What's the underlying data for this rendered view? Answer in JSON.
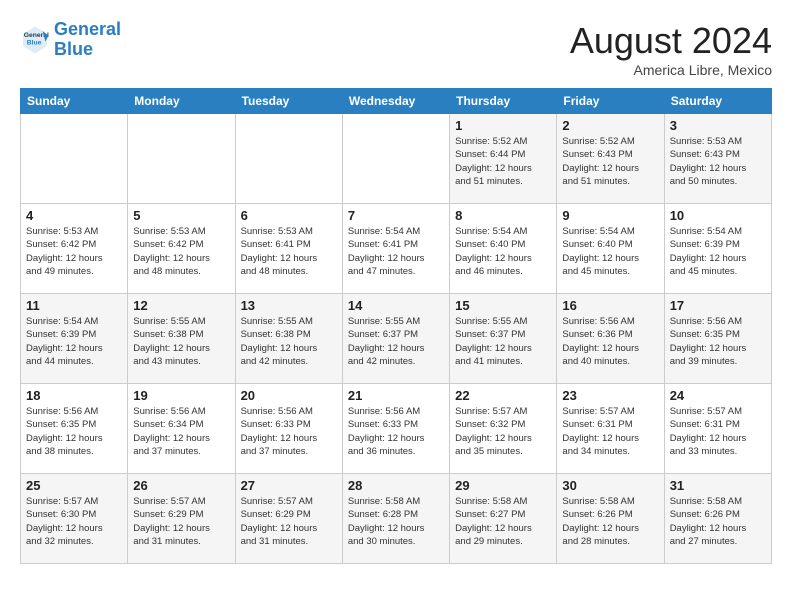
{
  "logo": {
    "line1": "General",
    "line2": "Blue"
  },
  "title": "August 2024",
  "subtitle": "America Libre, Mexico",
  "days_of_week": [
    "Sunday",
    "Monday",
    "Tuesday",
    "Wednesday",
    "Thursday",
    "Friday",
    "Saturday"
  ],
  "weeks": [
    [
      {
        "num": "",
        "info": ""
      },
      {
        "num": "",
        "info": ""
      },
      {
        "num": "",
        "info": ""
      },
      {
        "num": "",
        "info": ""
      },
      {
        "num": "1",
        "info": "Sunrise: 5:52 AM\nSunset: 6:44 PM\nDaylight: 12 hours\nand 51 minutes."
      },
      {
        "num": "2",
        "info": "Sunrise: 5:52 AM\nSunset: 6:43 PM\nDaylight: 12 hours\nand 51 minutes."
      },
      {
        "num": "3",
        "info": "Sunrise: 5:53 AM\nSunset: 6:43 PM\nDaylight: 12 hours\nand 50 minutes."
      }
    ],
    [
      {
        "num": "4",
        "info": "Sunrise: 5:53 AM\nSunset: 6:42 PM\nDaylight: 12 hours\nand 49 minutes."
      },
      {
        "num": "5",
        "info": "Sunrise: 5:53 AM\nSunset: 6:42 PM\nDaylight: 12 hours\nand 48 minutes."
      },
      {
        "num": "6",
        "info": "Sunrise: 5:53 AM\nSunset: 6:41 PM\nDaylight: 12 hours\nand 48 minutes."
      },
      {
        "num": "7",
        "info": "Sunrise: 5:54 AM\nSunset: 6:41 PM\nDaylight: 12 hours\nand 47 minutes."
      },
      {
        "num": "8",
        "info": "Sunrise: 5:54 AM\nSunset: 6:40 PM\nDaylight: 12 hours\nand 46 minutes."
      },
      {
        "num": "9",
        "info": "Sunrise: 5:54 AM\nSunset: 6:40 PM\nDaylight: 12 hours\nand 45 minutes."
      },
      {
        "num": "10",
        "info": "Sunrise: 5:54 AM\nSunset: 6:39 PM\nDaylight: 12 hours\nand 45 minutes."
      }
    ],
    [
      {
        "num": "11",
        "info": "Sunrise: 5:54 AM\nSunset: 6:39 PM\nDaylight: 12 hours\nand 44 minutes."
      },
      {
        "num": "12",
        "info": "Sunrise: 5:55 AM\nSunset: 6:38 PM\nDaylight: 12 hours\nand 43 minutes."
      },
      {
        "num": "13",
        "info": "Sunrise: 5:55 AM\nSunset: 6:38 PM\nDaylight: 12 hours\nand 42 minutes."
      },
      {
        "num": "14",
        "info": "Sunrise: 5:55 AM\nSunset: 6:37 PM\nDaylight: 12 hours\nand 42 minutes."
      },
      {
        "num": "15",
        "info": "Sunrise: 5:55 AM\nSunset: 6:37 PM\nDaylight: 12 hours\nand 41 minutes."
      },
      {
        "num": "16",
        "info": "Sunrise: 5:56 AM\nSunset: 6:36 PM\nDaylight: 12 hours\nand 40 minutes."
      },
      {
        "num": "17",
        "info": "Sunrise: 5:56 AM\nSunset: 6:35 PM\nDaylight: 12 hours\nand 39 minutes."
      }
    ],
    [
      {
        "num": "18",
        "info": "Sunrise: 5:56 AM\nSunset: 6:35 PM\nDaylight: 12 hours\nand 38 minutes."
      },
      {
        "num": "19",
        "info": "Sunrise: 5:56 AM\nSunset: 6:34 PM\nDaylight: 12 hours\nand 37 minutes."
      },
      {
        "num": "20",
        "info": "Sunrise: 5:56 AM\nSunset: 6:33 PM\nDaylight: 12 hours\nand 37 minutes."
      },
      {
        "num": "21",
        "info": "Sunrise: 5:56 AM\nSunset: 6:33 PM\nDaylight: 12 hours\nand 36 minutes."
      },
      {
        "num": "22",
        "info": "Sunrise: 5:57 AM\nSunset: 6:32 PM\nDaylight: 12 hours\nand 35 minutes."
      },
      {
        "num": "23",
        "info": "Sunrise: 5:57 AM\nSunset: 6:31 PM\nDaylight: 12 hours\nand 34 minutes."
      },
      {
        "num": "24",
        "info": "Sunrise: 5:57 AM\nSunset: 6:31 PM\nDaylight: 12 hours\nand 33 minutes."
      }
    ],
    [
      {
        "num": "25",
        "info": "Sunrise: 5:57 AM\nSunset: 6:30 PM\nDaylight: 12 hours\nand 32 minutes."
      },
      {
        "num": "26",
        "info": "Sunrise: 5:57 AM\nSunset: 6:29 PM\nDaylight: 12 hours\nand 31 minutes."
      },
      {
        "num": "27",
        "info": "Sunrise: 5:57 AM\nSunset: 6:29 PM\nDaylight: 12 hours\nand 31 minutes."
      },
      {
        "num": "28",
        "info": "Sunrise: 5:58 AM\nSunset: 6:28 PM\nDaylight: 12 hours\nand 30 minutes."
      },
      {
        "num": "29",
        "info": "Sunrise: 5:58 AM\nSunset: 6:27 PM\nDaylight: 12 hours\nand 29 minutes."
      },
      {
        "num": "30",
        "info": "Sunrise: 5:58 AM\nSunset: 6:26 PM\nDaylight: 12 hours\nand 28 minutes."
      },
      {
        "num": "31",
        "info": "Sunrise: 5:58 AM\nSunset: 6:26 PM\nDaylight: 12 hours\nand 27 minutes."
      }
    ]
  ]
}
